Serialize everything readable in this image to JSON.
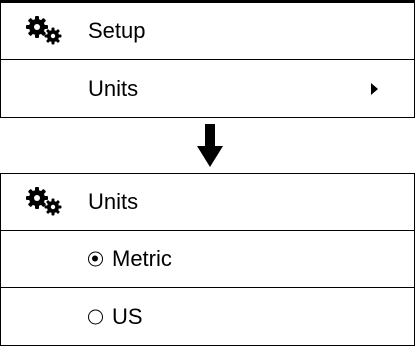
{
  "setup_menu": {
    "header": {
      "icon": "gears-icon",
      "title": "Setup"
    },
    "items": [
      {
        "label": "Units",
        "icon": "chevron-right-icon"
      }
    ]
  },
  "transition": {
    "icon": "arrow-down-icon"
  },
  "units_menu": {
    "header": {
      "icon": "gears-icon",
      "title": "Units"
    },
    "options": [
      {
        "label": "Metric",
        "selected": true
      },
      {
        "label": "US",
        "selected": false
      }
    ]
  }
}
